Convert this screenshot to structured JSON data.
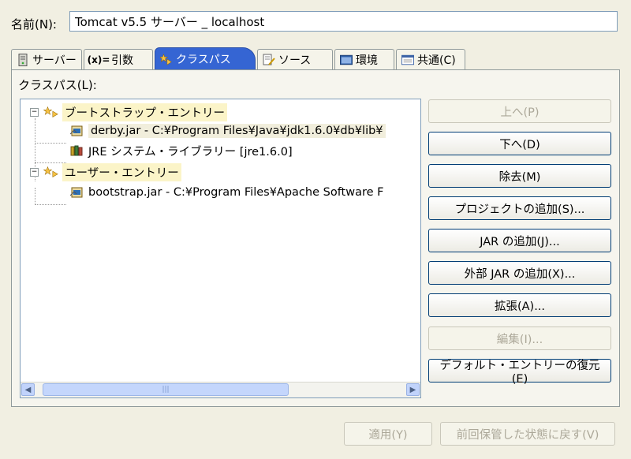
{
  "name": {
    "label": "名前(N):",
    "value": "Tomcat v5.5 サーバー _ localhost"
  },
  "tabs": [
    {
      "label": "サーバー",
      "icon": "server-icon"
    },
    {
      "label": "引数",
      "icon": "arguments-icon"
    },
    {
      "label": "クラスパス",
      "icon": "classpath-icon",
      "active": true
    },
    {
      "label": "ソース",
      "icon": "source-icon"
    },
    {
      "label": "環境",
      "icon": "environment-icon"
    },
    {
      "label": "共通(C)",
      "icon": "common-icon"
    }
  ],
  "classpath": {
    "label": "クラスパス(L):",
    "tree": {
      "bootstrap": {
        "label": "ブートストラップ・エントリー",
        "children": [
          "derby.jar - C:¥Program Files¥Java¥jdk1.6.0¥db¥lib¥",
          "JRE システム・ライブラリー [jre1.6.0]"
        ]
      },
      "user": {
        "label": "ユーザー・エントリー",
        "children": [
          "bootstrap.jar - C:¥Program Files¥Apache Software F"
        ]
      }
    }
  },
  "buttons": {
    "up": "上へ(P)",
    "down": "下へ(D)",
    "remove": "除去(M)",
    "add_project": "プロジェクトの追加(S)...",
    "add_jar": "JAR の追加(J)...",
    "add_external_jar": "外部 JAR の追加(X)...",
    "advanced": "拡張(A)...",
    "edit": "編集(I)...",
    "restore_default": "デフォルト・エントリーの復元(E)"
  },
  "footer": {
    "apply": "適用(Y)",
    "revert": "前回保管した状態に戻す(V)"
  },
  "colors": {
    "active_tab": "#3565d3",
    "button_border": "#003c74",
    "highlight": "#fbf4c8"
  }
}
